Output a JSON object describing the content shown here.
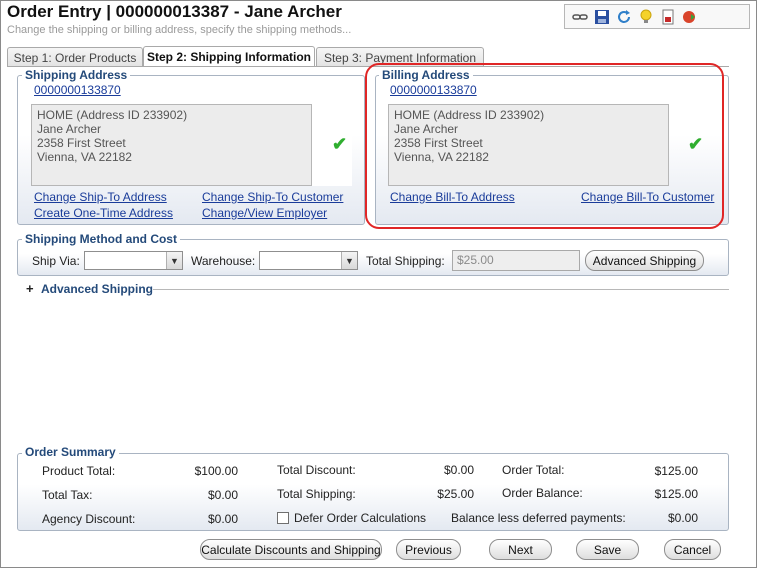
{
  "header": {
    "title": "Order Entry | 000000013387 - Jane Archer",
    "subtitle": "Change the shipping or billing address, specify the shipping methods..."
  },
  "toolbar": {
    "icons": [
      "link-icon",
      "save-icon",
      "refresh-icon",
      "lightbulb-icon",
      "report-icon",
      "cancel-icon"
    ]
  },
  "tabs": [
    {
      "label": "Step 1: Order Products",
      "active": false
    },
    {
      "label": "Step 2: Shipping Information",
      "active": true
    },
    {
      "label": "Step 3: Payment Information",
      "active": false
    }
  ],
  "shipping_address": {
    "legend": "Shipping Address",
    "customer_link": "000000013387",
    "index_link": "0",
    "address_lines": [
      "HOME (Address ID 233902)",
      "Jane Archer",
      "2358 First Street",
      "Vienna, VA 22182"
    ],
    "links": {
      "change_ship_to_address": "Change Ship-To Address",
      "change_ship_to_customer": "Change Ship-To Customer",
      "create_one_time_address": "Create One-Time Address",
      "change_view_employer": "Change/View Employer"
    }
  },
  "billing_address": {
    "legend": "Billing Address",
    "customer_link": "000000013387",
    "index_link": "0",
    "address_lines": [
      "HOME (Address ID 233902)",
      "Jane Archer",
      "2358 First Street",
      "Vienna, VA 22182"
    ],
    "links": {
      "change_bill_to_address": "Change Bill-To Address",
      "change_bill_to_customer": "Change Bill-To Customer"
    }
  },
  "shipping_method": {
    "legend": "Shipping Method and Cost",
    "ship_via_label": "Ship Via:",
    "ship_via_value": "",
    "warehouse_label": "Warehouse:",
    "warehouse_value": "",
    "total_shipping_label": "Total Shipping:",
    "total_shipping_value": "$25.00",
    "advanced_shipping_button": "Advanced Shipping"
  },
  "advanced_shipping_section": {
    "toggle": "+",
    "label": "Advanced Shipping"
  },
  "order_summary": {
    "legend": "Order Summary",
    "product_total_label": "Product Total:",
    "product_total_value": "$100.00",
    "total_tax_label": "Total Tax:",
    "total_tax_value": "$0.00",
    "agency_discount_label": "Agency Discount:",
    "agency_discount_value": "$0.00",
    "total_discount_label": "Total Discount:",
    "total_discount_value": "$0.00",
    "total_shipping_label": "Total Shipping:",
    "total_shipping_value": "$25.00",
    "defer_label": "Defer Order Calculations",
    "order_total_label": "Order Total:",
    "order_total_value": "$125.00",
    "order_balance_label": "Order Balance:",
    "order_balance_value": "$125.00",
    "balance_less_label": "Balance less deferred payments:",
    "balance_less_value": "$0.00"
  },
  "buttons": {
    "calculate": "Calculate Discounts and Shipping",
    "previous": "Previous",
    "next": "Next",
    "save": "Save",
    "cancel": "Cancel"
  },
  "colors": {
    "legend_text": "#244a7a",
    "link": "#1a3c9a",
    "highlight": "#e02626",
    "check": "#2fae2f"
  }
}
